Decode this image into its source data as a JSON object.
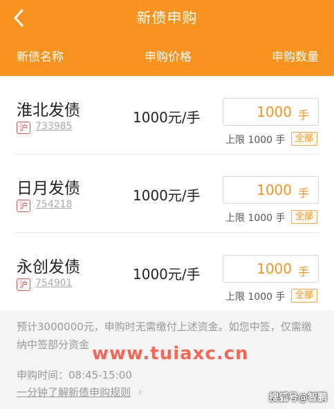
{
  "header": {
    "title": "新债申购",
    "columns": {
      "name": "新债名称",
      "price": "申购价格",
      "qty": "申购数量"
    }
  },
  "bonds": [
    {
      "name": "淮北发债",
      "market": "沪",
      "code": "733985",
      "price": "1000元/手",
      "qty": "1000",
      "unit": "手",
      "limit": "上限 1000 手",
      "all_label": "全部"
    },
    {
      "name": "日月发债",
      "market": "沪",
      "code": "754218",
      "price": "1000元/手",
      "qty": "1000",
      "unit": "手",
      "limit": "上限 1000 手",
      "all_label": "全部"
    },
    {
      "name": "永创发债",
      "market": "沪",
      "code": "754901",
      "price": "1000元/手",
      "qty": "1000",
      "unit": "手",
      "limit": "上限 1000 手",
      "all_label": "全部"
    }
  ],
  "footer": {
    "note": "预计3000000元，申购时无需缴付上述资金。如您中签，仅需缴纳中签部分资金",
    "time": "申购时间：08:45-15:00",
    "rules_link": "一分钟了解新债申购规则",
    "rules_chevron": "›"
  },
  "watermark": "www.tuiaxc.cn",
  "source_mark": "搜狐号@智鹏",
  "colors": {
    "accent": "#f7931e",
    "market_tag": "#e0554a"
  }
}
